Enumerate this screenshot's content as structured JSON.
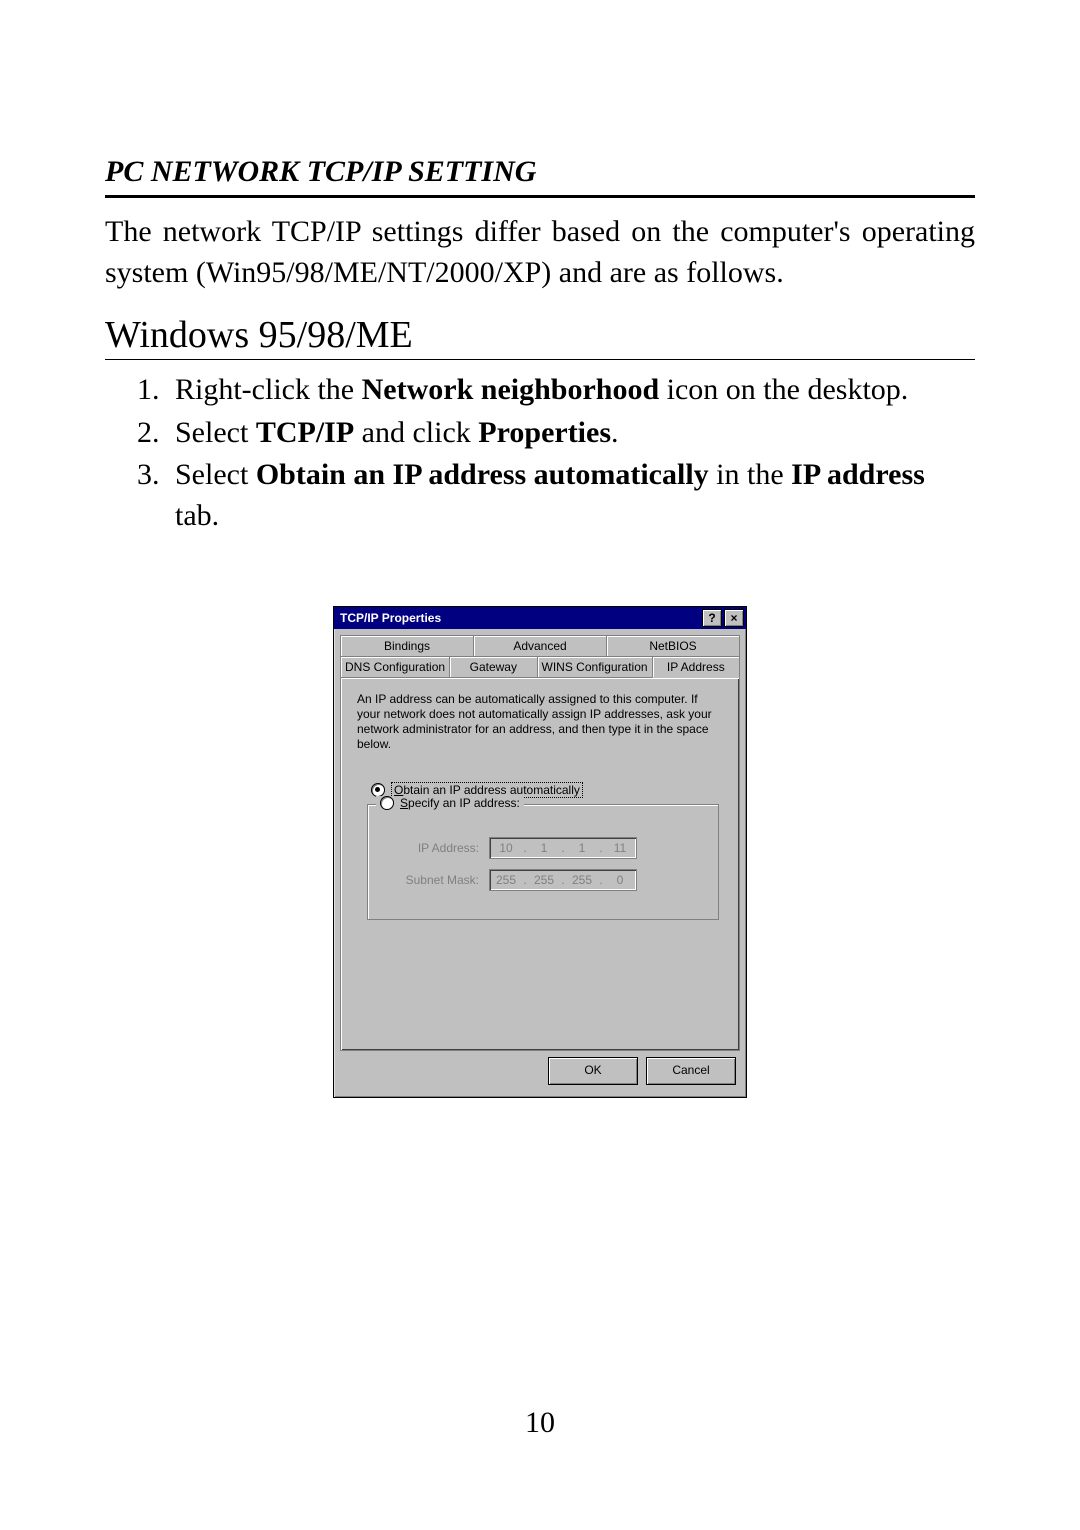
{
  "doc": {
    "section_title": "PC NETWORK TCP/IP SETTING",
    "intro": "The network TCP/IP settings differ based on the computer's operating system (Win95/98/ME/NT/2000/XP) and are as follows.",
    "subhead": "Windows 95/98/ME",
    "steps": [
      {
        "pre": "Right-click the ",
        "b1": "Network neighborhood",
        "post": " icon on the desktop."
      },
      {
        "pre": "Select ",
        "b1": "TCP/IP",
        "mid": " and click ",
        "b2": "Properties",
        "post": "."
      },
      {
        "pre": "Select ",
        "b1": "Obtain an IP address automatically",
        "mid": " in the ",
        "b2": "IP address",
        "post": " tab."
      }
    ],
    "page_number": "10"
  },
  "dialog": {
    "title": "TCP/IP Properties",
    "help_glyph": "?",
    "close_glyph": "×",
    "tabs_row1": [
      "Bindings",
      "Advanced",
      "NetBIOS"
    ],
    "tabs_row2": [
      "DNS Configuration",
      "Gateway",
      "WINS Configuration",
      "IP Address"
    ],
    "active_tab_index_row2": 3,
    "description": "An IP address can be automatically assigned to this computer. If your network does not automatically assign IP addresses, ask your network administrator for an address, and then type it in the space below.",
    "radio_obtain": {
      "ul": "O",
      "rest": "btain an IP address automatically",
      "checked": true
    },
    "radio_specify": {
      "ul": "S",
      "rest": "pecify an IP address:",
      "checked": false
    },
    "ip_label": "IP Address:",
    "ip_value": [
      "10",
      "1",
      "1",
      "11"
    ],
    "mask_label": "Subnet Mask:",
    "mask_value": [
      "255",
      "255",
      "255",
      "0"
    ],
    "ok_label": "OK",
    "cancel_label": "Cancel"
  }
}
